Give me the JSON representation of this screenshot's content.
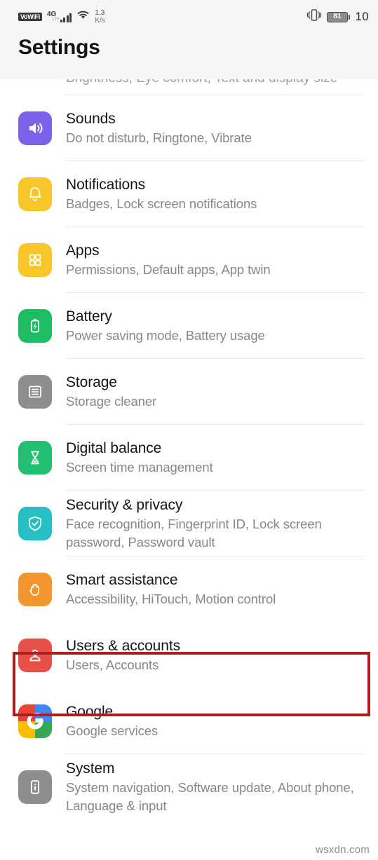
{
  "status_bar": {
    "vowifi_label": "VoWiFi",
    "network_type": "4G",
    "network_sub": "LTE",
    "signal_icon": "signal-bars-icon",
    "wifi_icon": "wifi-icon",
    "data_speed_value": "1.3",
    "data_speed_unit": "K/s",
    "vibrate_icon": "vibrate-icon",
    "battery_level": "81",
    "battery_icon": "battery-icon",
    "clock": "10"
  },
  "header": {
    "title": "Settings"
  },
  "scrolled_partial_row": {
    "subtitle": "Brightness, Eye comfort, Text and display size"
  },
  "annotation": {
    "highlight_color": "#ad1f1f",
    "target": "Users & accounts"
  },
  "watermark": {
    "text": "wsxdn.com"
  },
  "settings_list": [
    {
      "title": "Sounds",
      "subtitle": "Do not disturb, Ringtone, Vibrate",
      "icon": "speaker-icon",
      "icon_color": "#7b62e8"
    },
    {
      "title": "Notifications",
      "subtitle": "Badges, Lock screen notifications",
      "icon": "bell-icon",
      "icon_color": "#f9c62a"
    },
    {
      "title": "Apps",
      "subtitle": "Permissions, Default apps, App twin",
      "icon": "grid-apps-icon",
      "icon_color": "#f9c62a"
    },
    {
      "title": "Battery",
      "subtitle": "Power saving mode, Battery usage",
      "icon": "battery-bolt-icon",
      "icon_color": "#1fbd63"
    },
    {
      "title": "Storage",
      "subtitle": "Storage cleaner",
      "icon": "storage-lines-icon",
      "icon_color": "#8e8e8e"
    },
    {
      "title": "Digital balance",
      "subtitle": "Screen time management",
      "icon": "hourglass-icon",
      "icon_color": "#22be72"
    },
    {
      "title": "Security & privacy",
      "subtitle": "Face recognition, Fingerprint ID, Lock screen password, Password vault",
      "icon": "shield-check-icon",
      "icon_color": "#26bfc4"
    },
    {
      "title": "Smart assistance",
      "subtitle": "Accessibility, HiTouch, Motion control",
      "icon": "hand-icon",
      "icon_color": "#f0962c"
    },
    {
      "title": "Users & accounts",
      "subtitle": "Users, Accounts",
      "icon": "person-icon",
      "icon_color": "#e8504a"
    },
    {
      "title": "Google",
      "subtitle": "Google services",
      "icon": "google-logo-icon",
      "icon_color": "#ffffff"
    },
    {
      "title": "System",
      "subtitle": "System navigation, Software update, About phone, Language & input",
      "icon": "phone-info-icon",
      "icon_color": "#8e8e8e"
    }
  ]
}
